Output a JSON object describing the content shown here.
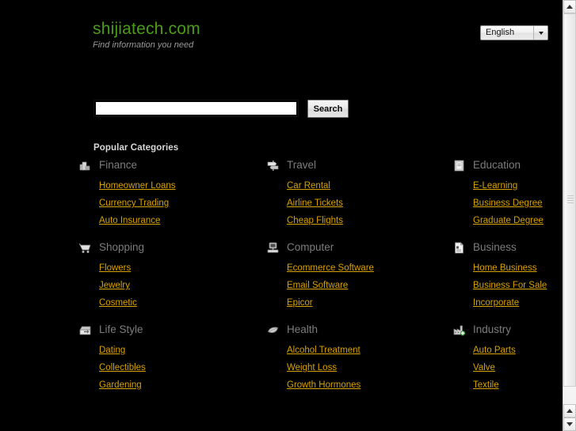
{
  "site": {
    "logo_text": "shijiatech.com",
    "tagline": "Find information you need",
    "logo_color": "#4a9c18",
    "link_color": "#d8a102",
    "heading_color": "#7d7d7d",
    "background_color": "#000000"
  },
  "language": {
    "selected": "English",
    "arrow_icon": "chevron-down-icon"
  },
  "search": {
    "value": "",
    "placeholder": "",
    "button_label": "Search"
  },
  "categories": {
    "heading": "Popular Categories",
    "rows": [
      [
        {
          "title": "Finance",
          "icon": "money-stack-icon",
          "links": [
            "Homeowner Loans",
            "Currency Trading",
            "Auto Insurance"
          ]
        },
        {
          "title": "Travel",
          "icon": "signpost-icon",
          "links": [
            "Car Rental",
            "Airline Tickets",
            "Cheap Flights"
          ]
        },
        {
          "title": "Education",
          "icon": "book-icon",
          "links": [
            "E-Learning",
            "Business Degree",
            "Graduate Degree"
          ]
        }
      ],
      [
        {
          "title": "Shopping",
          "icon": "shopping-cart-icon",
          "links": [
            "Flowers",
            "Jewelry",
            "Cosmetic"
          ]
        },
        {
          "title": "Computer",
          "icon": "desktop-computer-icon",
          "links": [
            "Ecommerce Software",
            "Email Software",
            "Epicor"
          ]
        },
        {
          "title": "Business",
          "icon": "document-icon",
          "links": [
            "Home Business",
            "Business For Sale",
            "Incorporate"
          ]
        }
      ],
      [
        {
          "title": "Life Style",
          "icon": "inbox-arrow-icon",
          "links": [
            "Dating",
            "Collectibles",
            "Gardening"
          ]
        },
        {
          "title": "Health",
          "icon": "leaf-icon",
          "links": [
            "Alcohol Treatment",
            "Weight Loss",
            "Growth Hormones"
          ]
        },
        {
          "title": "Industry",
          "icon": "factory-icon",
          "links": [
            "Auto Parts",
            "Valve",
            "Textile"
          ]
        }
      ]
    ]
  },
  "scrollbar": {
    "up_icon": "scroll-up-arrow-icon",
    "down_icon": "scroll-down-arrow-icon"
  }
}
